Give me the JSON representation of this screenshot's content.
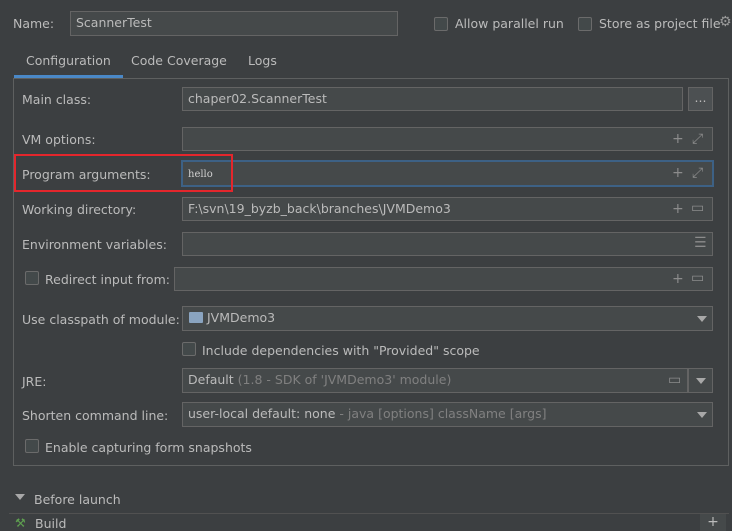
{
  "header": {
    "name_label": "Name:",
    "name_value": "ScannerTest",
    "allow_parallel": "Allow parallel run",
    "store_project": "Store as project file"
  },
  "tabs": [
    {
      "label": "Configuration",
      "active": true
    },
    {
      "label": "Code Coverage",
      "active": false
    },
    {
      "label": "Logs",
      "active": false
    }
  ],
  "form": {
    "main_class_label": "Main class:",
    "main_class_value": "chaper02.ScannerTest",
    "browse_label": "...",
    "vm_options_label": "VM options:",
    "vm_options_value": "",
    "program_args_label": "Program arguments:",
    "program_args_value": "hello",
    "working_dir_label": "Working directory:",
    "working_dir_value": "F:\\svn\\19_byzb_back\\branches\\JVMDemo3",
    "env_vars_label": "Environment variables:",
    "env_vars_value": "",
    "redirect_label": "Redirect input from:",
    "redirect_value": "",
    "classpath_label": "Use classpath of module:",
    "classpath_value": "JVMDemo3",
    "include_deps_label": "Include dependencies with \"Provided\" scope",
    "jre_label": "JRE:",
    "jre_value": "Default",
    "jre_hint": "(1.8 - SDK of 'JVMDemo3' module)",
    "shorten_label": "Shorten command line:",
    "shorten_value": "user-local default: none",
    "shorten_hint": "- java [options] className [args]",
    "capture_label": "Enable capturing form snapshots"
  },
  "before_launch": {
    "title": "Before launch",
    "item": "Build",
    "add": "+"
  },
  "icons": {
    "expand": "⤢",
    "add": "+",
    "folder": "folder-icon",
    "list": "list-icon",
    "gear": "gear-icon"
  },
  "colors": {
    "background": "#3c3f41",
    "field": "#45494a",
    "focus_border": "#3d6185",
    "tab_accent": "#4a88c7",
    "highlight_box": "#e4262c"
  }
}
